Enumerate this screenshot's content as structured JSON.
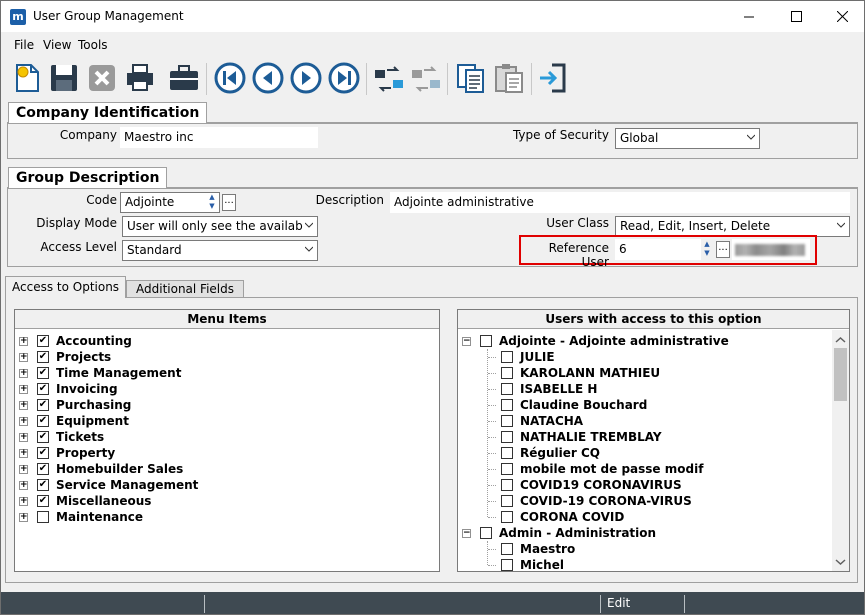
{
  "window": {
    "title": "User Group Management",
    "app_icon": "m"
  },
  "menu": [
    "File",
    "View",
    "Tools"
  ],
  "toolbar_icons": [
    "new-document-icon",
    "save-icon",
    "delete-icon",
    "print-icon",
    "briefcase-icon",
    "first-record-icon",
    "previous-record-icon",
    "next-record-icon",
    "last-record-icon",
    "transfer-icon",
    "transfer-disabled-icon",
    "copy-document-icon",
    "paste-document-icon",
    "exit-icon"
  ],
  "company_identification": {
    "title": "Company Identification",
    "company_label": "Company",
    "company_value": "Maestro inc",
    "security_label": "Type of Security",
    "security_value": "Global"
  },
  "group_description": {
    "title": "Group Description",
    "code_label": "Code",
    "code_value": "Adjointe",
    "display_mode_label": "Display Mode",
    "display_mode_value": "User will only see the availab",
    "access_level_label": "Access Level",
    "access_level_value": "Standard",
    "description_label": "Description",
    "description_value": "Adjointe administrative",
    "user_class_label": "User Class",
    "user_class_value": "Read, Edit, Insert, Delete",
    "reference_user_label": "Reference User",
    "reference_user_value": "6",
    "reference_user_name": "ISABELLE H"
  },
  "tabs": [
    "Access to Options",
    "Additional Fields"
  ],
  "menu_items": {
    "header": "Menu Items",
    "items": [
      {
        "label": "Accounting",
        "checked": true
      },
      {
        "label": "Projects",
        "checked": true
      },
      {
        "label": "Time Management",
        "checked": true
      },
      {
        "label": "Invoicing",
        "checked": true
      },
      {
        "label": "Purchasing",
        "checked": true
      },
      {
        "label": "Equipment",
        "checked": true
      },
      {
        "label": "Tickets",
        "checked": true
      },
      {
        "label": "Property",
        "checked": true
      },
      {
        "label": "Homebuilder Sales",
        "checked": true
      },
      {
        "label": "Service Management",
        "checked": true
      },
      {
        "label": "Miscellaneous",
        "checked": true
      },
      {
        "label": "Maintenance",
        "checked": false
      }
    ]
  },
  "users_access": {
    "header": "Users with access to this option",
    "groups": [
      {
        "label": "Adjointe - Adjointe administrative",
        "users": [
          "JULIE",
          "KAROLANN MATHIEU",
          "ISABELLE H",
          "Claudine Bouchard",
          "NATACHA",
          "NATHALIE TREMBLAY",
          "Régulier CQ",
          "mobile mot de passe modif",
          "COVID19 CORONAVIRUS",
          "COVID-19 CORONA-VIRUS",
          "CORONA COVID"
        ]
      },
      {
        "label": "Admin - Administration",
        "users": [
          "Maestro",
          "Michel"
        ]
      }
    ]
  },
  "status": {
    "mode": "Edit"
  }
}
